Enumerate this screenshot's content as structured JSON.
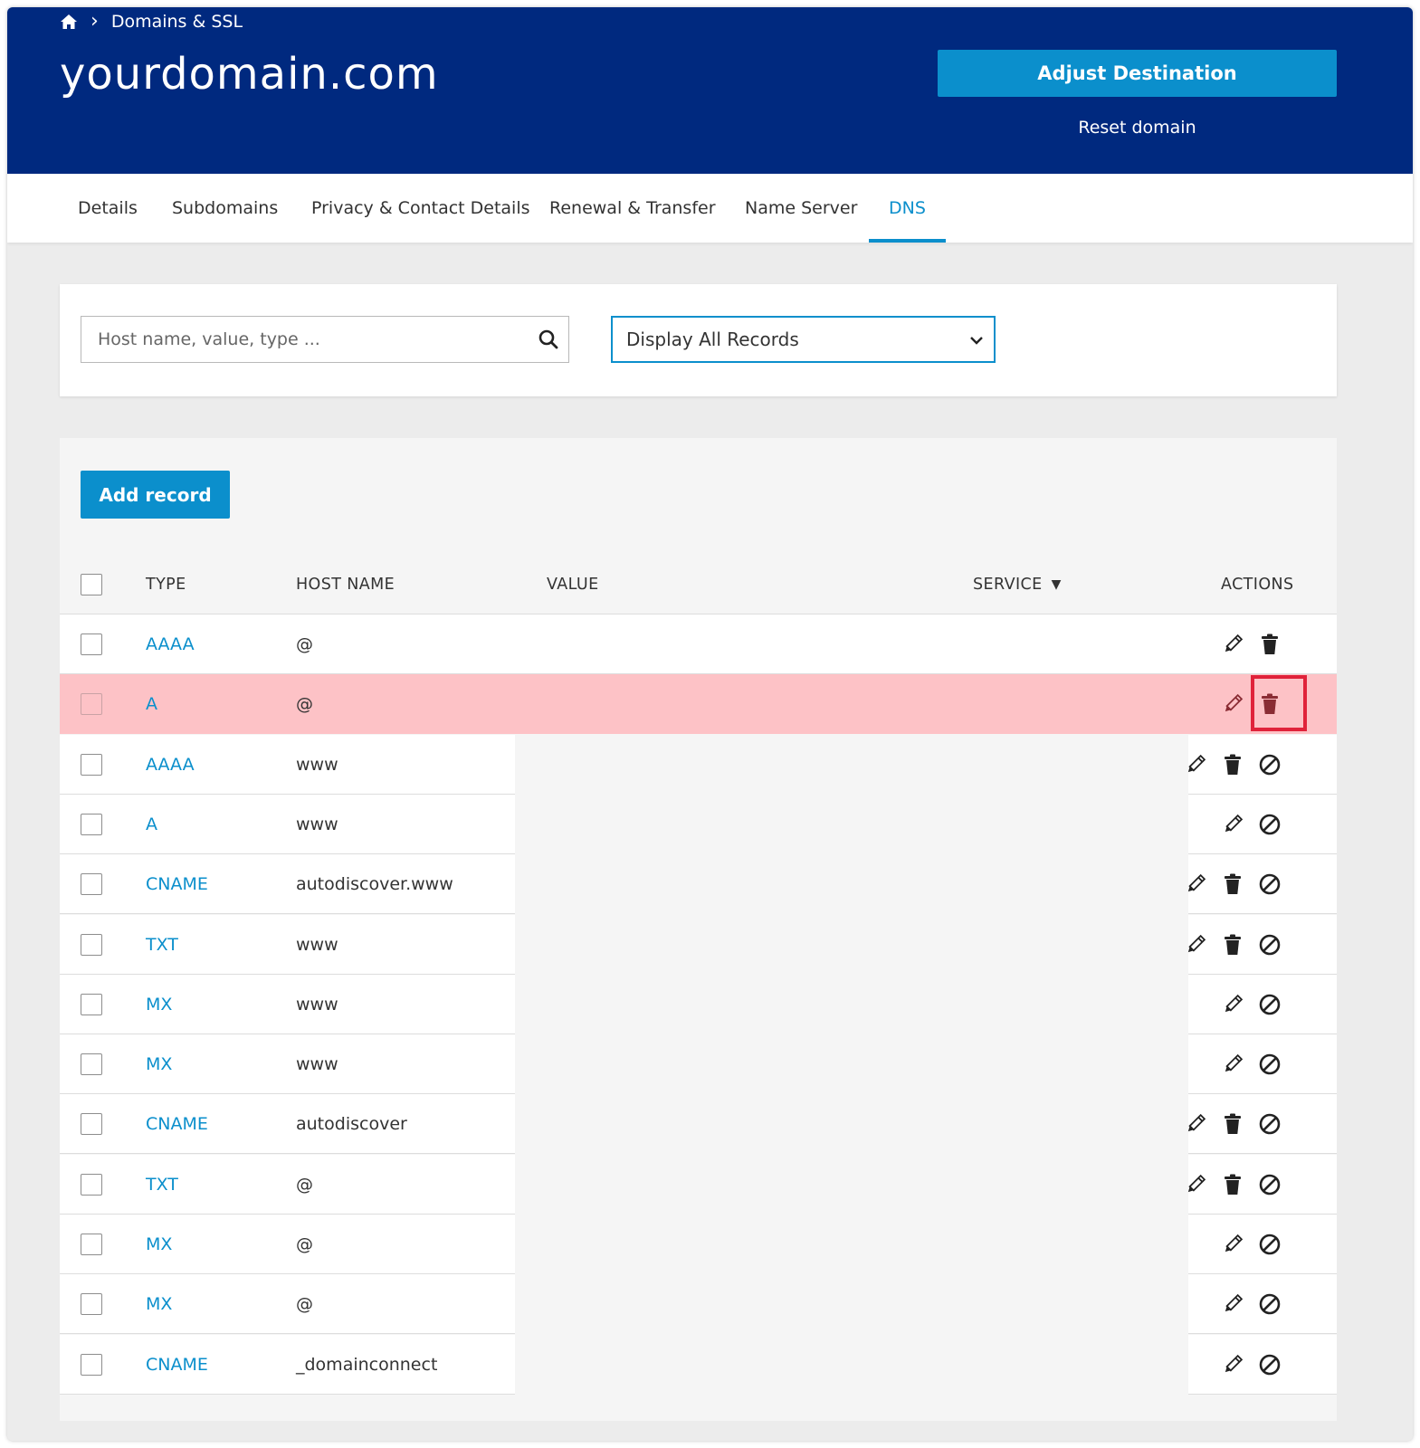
{
  "header": {
    "breadcrumb": "Domains & SSL",
    "domain": "yourdomain.com",
    "adjust_button": "Adjust Destination",
    "reset_link": "Reset domain"
  },
  "tabs": [
    {
      "label": "Details"
    },
    {
      "label": "Subdomains"
    },
    {
      "label": "Privacy & Contact Details"
    },
    {
      "label": "Renewal & Transfer"
    },
    {
      "label": "Name Server"
    },
    {
      "label": "DNS",
      "active": true
    }
  ],
  "filter": {
    "search_placeholder": "Host name, value, type ...",
    "select_value": "Display All Records"
  },
  "records": {
    "add_button": "Add record",
    "columns": {
      "type": "TYPE",
      "host": "HOST NAME",
      "value": "VALUE",
      "service": "SERVICE",
      "actions": "ACTIONS"
    },
    "rows": [
      {
        "type": "AAAA",
        "host": "@",
        "actions": [
          "edit",
          "delete"
        ]
      },
      {
        "type": "A",
        "host": "@",
        "actions": [
          "edit",
          "delete"
        ],
        "highlighted": true
      },
      {
        "type": "AAAA",
        "host": "www",
        "actions": [
          "edit",
          "delete",
          "disable"
        ]
      },
      {
        "type": "A",
        "host": "www",
        "actions": [
          "edit",
          "disable"
        ]
      },
      {
        "type": "CNAME",
        "host": "autodiscover.www",
        "actions": [
          "edit",
          "delete",
          "disable"
        ]
      },
      {
        "type": "TXT",
        "host": "www",
        "actions": [
          "edit",
          "delete",
          "disable"
        ]
      },
      {
        "type": "MX",
        "host": "www",
        "actions": [
          "edit",
          "disable"
        ]
      },
      {
        "type": "MX",
        "host": "www",
        "actions": [
          "edit",
          "disable"
        ]
      },
      {
        "type": "CNAME",
        "host": "autodiscover",
        "actions": [
          "edit",
          "delete",
          "disable"
        ]
      },
      {
        "type": "TXT",
        "host": "@",
        "actions": [
          "edit",
          "delete",
          "disable"
        ]
      },
      {
        "type": "MX",
        "host": "@",
        "actions": [
          "edit",
          "disable"
        ]
      },
      {
        "type": "MX",
        "host": "@",
        "actions": [
          "edit",
          "disable"
        ]
      },
      {
        "type": "CNAME",
        "host": "_domainconnect",
        "actions": [
          "edit",
          "disable"
        ]
      }
    ]
  },
  "colors": {
    "header_bg": "#00297f",
    "accent": "#0b8fcc",
    "highlight_row": "#fdc2c6",
    "highlight_box": "#e0223a"
  }
}
